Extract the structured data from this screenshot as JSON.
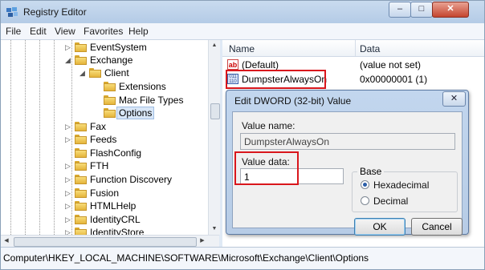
{
  "window": {
    "title": "Registry Editor",
    "app_icon": "registry-editor-icon",
    "minimize": "–",
    "maximize": "□",
    "close": "✕"
  },
  "menu": [
    "File",
    "Edit",
    "View",
    "Favorites",
    "Help"
  ],
  "tree": {
    "items": [
      {
        "label": "EventSystem",
        "expander": "▷",
        "selected": false
      },
      {
        "label": "Exchange",
        "expander": "◢",
        "selected": false
      },
      {
        "label": "Client",
        "expander": "◢",
        "selected": false
      },
      {
        "label": "Extensions",
        "expander": "",
        "selected": false
      },
      {
        "label": "Mac File Types",
        "expander": "",
        "selected": false
      },
      {
        "label": "Options",
        "expander": "",
        "selected": true
      },
      {
        "label": "Fax",
        "expander": "▷",
        "selected": false
      },
      {
        "label": "Feeds",
        "expander": "▷",
        "selected": false
      },
      {
        "label": "FlashConfig",
        "expander": "",
        "selected": false
      },
      {
        "label": "FTH",
        "expander": "▷",
        "selected": false
      },
      {
        "label": "Function Discovery",
        "expander": "▷",
        "selected": false
      },
      {
        "label": "Fusion",
        "expander": "▷",
        "selected": false
      },
      {
        "label": "HTMLHelp",
        "expander": "▷",
        "selected": false
      },
      {
        "label": "IdentityCRL",
        "expander": "▷",
        "selected": false
      },
      {
        "label": "IdentityStore",
        "expander": "▷",
        "selected": false
      }
    ]
  },
  "list": {
    "columns": {
      "name": "Name",
      "data": "Data"
    },
    "rows": [
      {
        "icon": "string-value-icon",
        "icon_text": "ab",
        "name": "(Default)",
        "data": "(value not set)"
      },
      {
        "icon": "binary-value-icon",
        "icon_text": "011 110",
        "name": "DumpsterAlwaysOn",
        "data": "0x00000001 (1)"
      }
    ]
  },
  "status": {
    "path": "Computer\\HKEY_LOCAL_MACHINE\\SOFTWARE\\Microsoft\\Exchange\\Client\\Options"
  },
  "dialog": {
    "title": "Edit DWORD (32-bit) Value",
    "close": "✕",
    "value_name_label": "Value name:",
    "value_name": "DumpsterAlwaysOn",
    "value_data_label": "Value data:",
    "value_data": "1",
    "base_label": "Base",
    "base_options": [
      {
        "label": "Hexadecimal",
        "checked": true
      },
      {
        "label": "Decimal",
        "checked": false
      }
    ],
    "ok_label": "OK",
    "cancel_label": "Cancel"
  },
  "colors": {
    "highlight": "#d9161c",
    "selection": "#d8e6f7",
    "title_gradient": "#b4cbe6"
  }
}
